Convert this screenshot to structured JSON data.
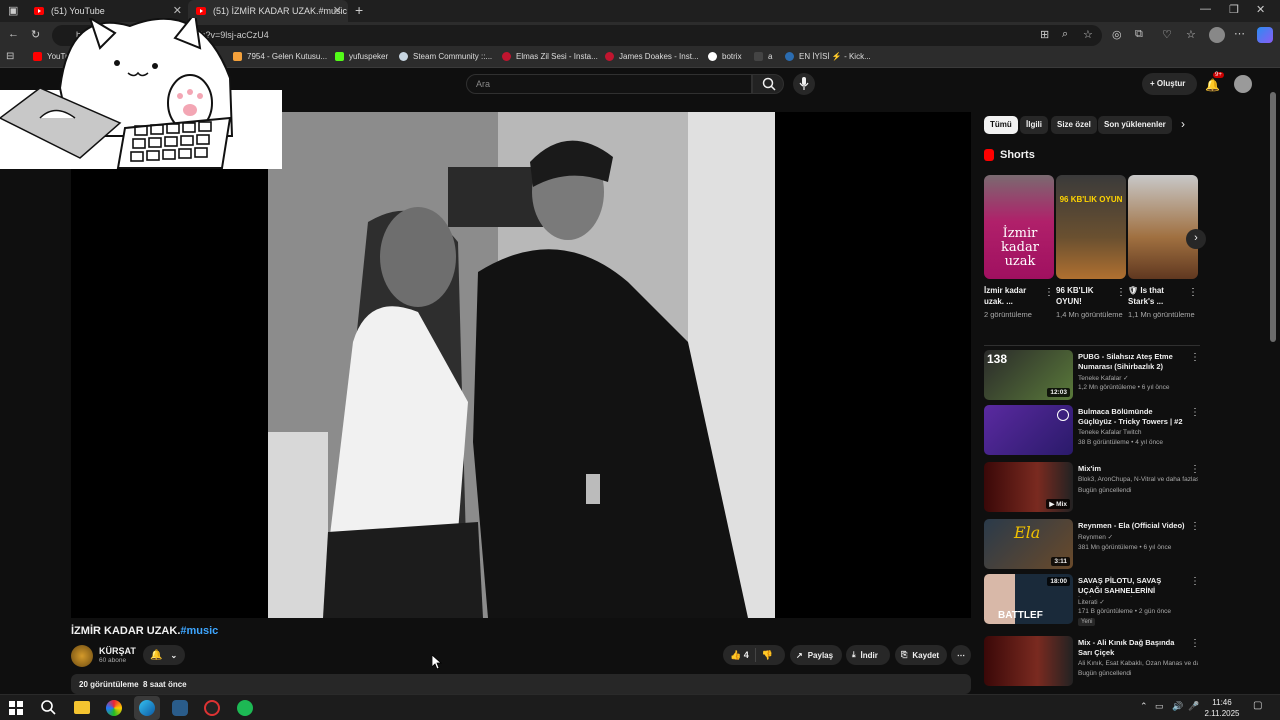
{
  "browser": {
    "tabs": [
      {
        "label": "(51) YouTube"
      },
      {
        "label": "(51) İZMİR KADAR UZAK.#music"
      }
    ],
    "url": "https://www.youtube.com/watch?v=9lsj-acCzU4",
    "url_visible_start": "https",
    "url_visible_end": "/watch?v=9lsj-acCzU4",
    "bookmarks": [
      {
        "label": "YouTube",
        "color": "#ff0000"
      },
      {
        "label": "7954 - Gelen Kutusu...",
        "color": "#f4a13b"
      },
      {
        "label": "yufuspeker",
        "color": "#53fc18"
      },
      {
        "label": "Steam Community ::...",
        "color": "#1b2838"
      },
      {
        "label": "Elmas Zil Sesi - Insta...",
        "color": "#c0152f"
      },
      {
        "label": "James Doakes - Inst...",
        "color": "#c0152f"
      },
      {
        "label": "botrix",
        "color": "#ffffff"
      },
      {
        "label": "a",
        "color": "#444444"
      },
      {
        "label": "EN İYİSİ ⚡ - Kick...",
        "color": "#53fc18"
      }
    ]
  },
  "youtube": {
    "search_placeholder": "Ara",
    "create_label": "Oluştur",
    "notifications_count": "9+",
    "video": {
      "title_main": "İZMİR KADAR UZAK.",
      "title_tag": "#music",
      "channel_name": "KÜRŞAT",
      "subscribers": "60 abone",
      "likes": "4",
      "share_label": "Paylaş",
      "download_label": "İndir",
      "save_label": "Kaydet",
      "views": "20 görüntüleme",
      "age": "8 saat önce"
    },
    "chips": [
      {
        "label": "Tümü",
        "active": true
      },
      {
        "label": "İlgili",
        "active": false
      },
      {
        "label": "Size özel",
        "active": false
      },
      {
        "label": "Son yüklenenler",
        "active": false
      }
    ],
    "shorts_header": "Shorts",
    "shorts": [
      {
        "title": "İzmir kadar uzak. ...",
        "views": "2 görüntüleme",
        "thumb_text": "İzmir kadar uzak"
      },
      {
        "title": "96 KB'LIK OYUN!",
        "views": "1,4 Mn görüntüleme",
        "thumb_text": "96 KB'LIK OYUN"
      },
      {
        "title": "🛡 Is that Stark's ...",
        "views": "1,1 Mn görüntüleme",
        "thumb_text": ""
      }
    ],
    "recommendations": [
      {
        "title": "PUBG - Silahsız Ateş Etme Numarası (Sihirbazlık 2)",
        "channel": "Teneke Kafalar ✓",
        "meta": "1,2 Mn görüntüleme • 6 yıl önce",
        "duration": "12:03",
        "badge": "",
        "thumb_color": "#3a5a3a",
        "thumb_text": "138"
      },
      {
        "title": "Bulmaca Bölümünde Güçlüyüz - Tricky Towers | #2",
        "channel": "Teneke Kafalar Twitch",
        "meta": "38 B görüntüleme • 4 yıl önce",
        "duration": "",
        "badge": "",
        "thumb_color": "#4a2a8a",
        "thumb_text": ""
      },
      {
        "title": "Mix'im",
        "channel": "Blok3, AronChupa, N-Vitral ve daha fazlası",
        "meta": "Bugün güncellendi",
        "duration": "Mix",
        "badge": "",
        "thumb_color": "#5a1010",
        "thumb_text": ""
      },
      {
        "title": "Reynmen - Ela (Official Video)",
        "channel": "Reynmen ✓",
        "meta": "381 Mn görüntüleme • 6 yıl önce",
        "duration": "3:11",
        "badge": "",
        "thumb_color": "#2a3a4a",
        "thumb_text": "Ela"
      },
      {
        "title": "SAVAŞ PİLOTU, SAVAŞ UÇAĞI SAHNELERİNİ İZLİYOR! (YENİ ...",
        "channel": "Literati ✓",
        "meta": "171 B görüntüleme • 2 gün önce",
        "duration": "18:00",
        "badge": "Yeni",
        "thumb_color": "#1a2a3a",
        "thumb_text": "BATTLEF"
      },
      {
        "title": "Mix - Ali Kınık Dağ Başında Sarı Çiçek",
        "channel": "Ali Kınık, Esat Kabaklı, Ozan Manas ve da...",
        "meta": "Bugün güncellendi",
        "duration": "",
        "badge": "",
        "thumb_color": "#5a1010",
        "thumb_text": ""
      }
    ]
  },
  "taskbar": {
    "time": "11:46",
    "date": "2.11.2025"
  }
}
